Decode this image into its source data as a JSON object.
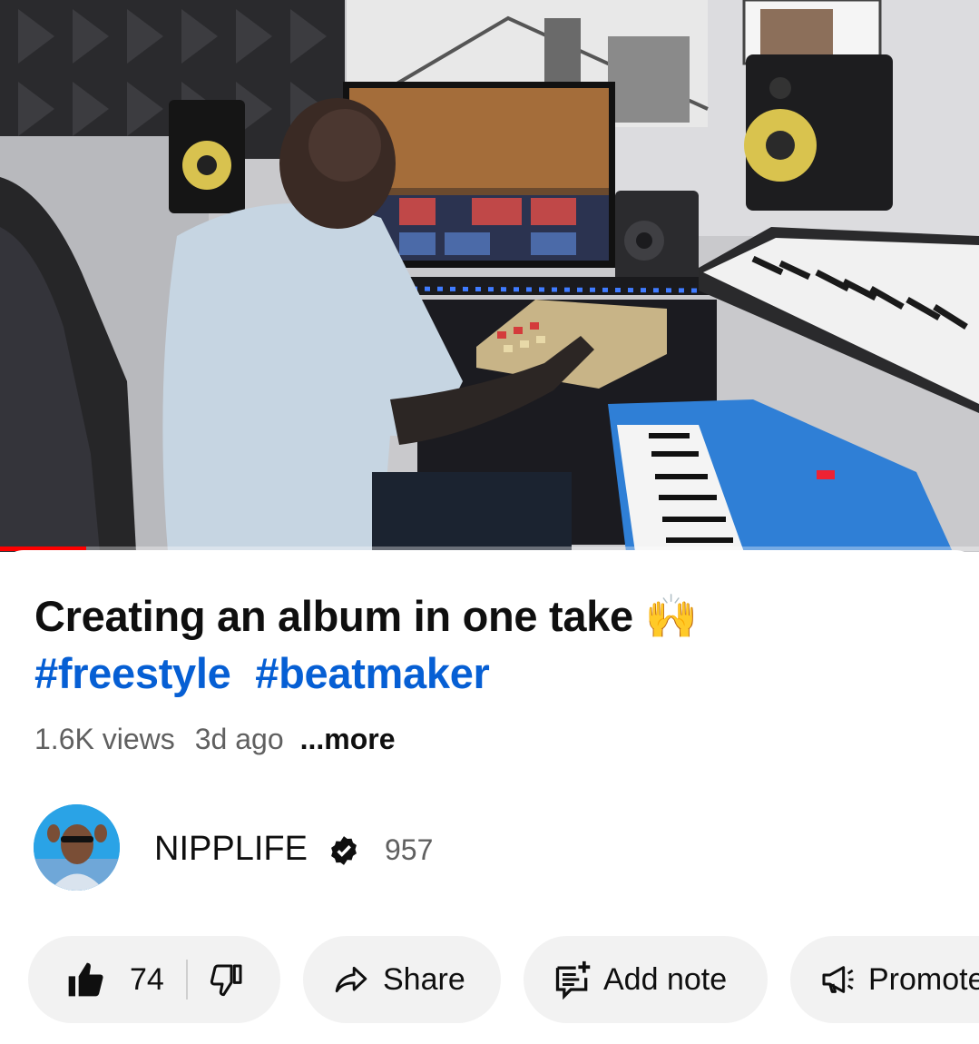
{
  "video": {
    "progress_fraction": 0.088,
    "title": "Creating an album in one take",
    "title_emoji": "🙌",
    "hashtags": [
      "#freestyle",
      "#beatmaker"
    ],
    "views": "1.6K views",
    "age": "3d ago",
    "more_label": "...more"
  },
  "channel": {
    "name": "NIPPLIFE",
    "subscribers": "957",
    "verified_icon": "verified-badge-icon"
  },
  "actions": {
    "likes": "74",
    "like_icon": "thumbs-up-icon",
    "dislike_icon": "thumbs-down-icon",
    "share_label": "Share",
    "share_icon": "share-arrow-icon",
    "note_label": "Add note",
    "note_icon": "add-note-icon",
    "promote_label": "Promote",
    "promote_icon": "megaphone-icon"
  },
  "colors": {
    "progress": "#ff0000",
    "hashtag": "#065fd4",
    "pill_bg": "#f2f2f2"
  }
}
